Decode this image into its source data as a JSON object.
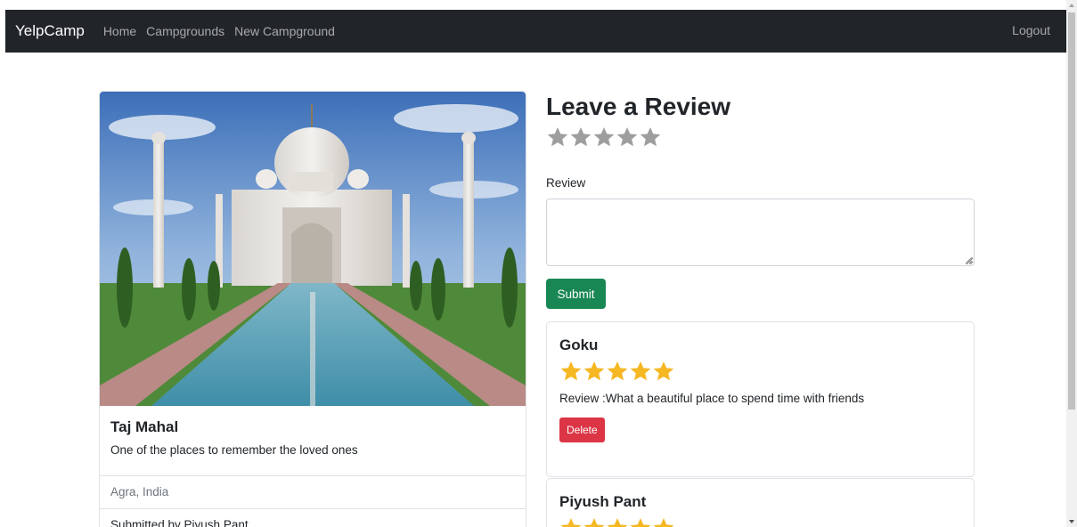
{
  "navbar": {
    "brand": "YelpCamp",
    "links": [
      "Home",
      "Campgrounds",
      "New Campground"
    ],
    "logout": "Logout"
  },
  "campground": {
    "title": "Taj Mahal",
    "description": "One of the places to remember the loved ones",
    "location": "Agra, India",
    "submitted_by": "Submitted by Piyush Pant"
  },
  "review_form": {
    "heading": "Leave a Review",
    "rating": 0,
    "rating_max": 5,
    "label": "Review",
    "textarea_value": "",
    "submit_label": "Submit"
  },
  "reviews": [
    {
      "author": "Goku",
      "rating": 5,
      "text": "Review :What a beautiful place to spend time with friends",
      "delete_label": "Delete"
    },
    {
      "author": "Piyush Pant",
      "rating": 5
    }
  ],
  "colors": {
    "navbar_bg": "#212529",
    "submit_green": "#198754",
    "delete_red": "#dc3545",
    "star_filled": "#f5b722",
    "star_empty": "#9e9e9e"
  },
  "icons": [
    "star-icon",
    "resize-grip-icon",
    "scroll-up-arrow-icon",
    "scroll-down-arrow-icon"
  ]
}
